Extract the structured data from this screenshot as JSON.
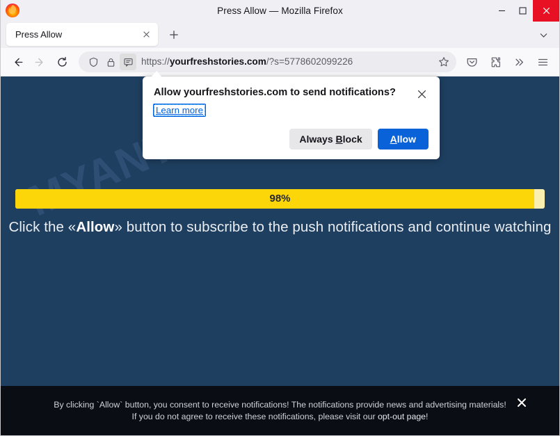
{
  "window": {
    "title": "Press Allow — Mozilla Firefox",
    "controls": {
      "minimize": "minimize",
      "maximize": "maximize",
      "close": "close"
    }
  },
  "tabs": {
    "items": [
      {
        "label": "Press Allow",
        "close_label": "Close tab"
      }
    ],
    "new_tab_label": "Open a new tab",
    "list_all_label": "List all tabs"
  },
  "toolbar": {
    "back_label": "Go back one page",
    "forward_label": "Go forward one page",
    "reload_label": "Reload current page",
    "shield_label": "Enhanced tracking protection",
    "lock_label": "Connection secure",
    "permission_label": "Notifications permission requested",
    "bookmark_label": "Bookmark this page",
    "pocket_label": "Save to Pocket",
    "extensions_label": "Extensions",
    "overflow_label": "More tools",
    "menu_label": "Open application menu"
  },
  "urlbar": {
    "scheme": "https://",
    "host": "yourfreshstories.com",
    "path": "/?s=5778602099226",
    "full_url": "https://yourfreshstories.com/?s=5778602099226"
  },
  "doorhanger": {
    "title": "Allow yourfreshstories.com to send notifications?",
    "learn_more": "Learn more",
    "close_label": "Close",
    "block_button": "Always Block",
    "block_button_pre": "Always ",
    "block_button_accel": "B",
    "block_button_post": "lock",
    "allow_button": "Allow",
    "allow_button_accel": "A",
    "allow_button_post": "llow",
    "primary_color": "#0a62d8"
  },
  "page": {
    "watermark": "MYANTISPYWARE.COM",
    "progress": {
      "percent_label": "98%",
      "percent_value": 98,
      "fill_color": "#fdd60a",
      "track_color": "#fbefb0"
    },
    "cta": {
      "prefix": "Click the «",
      "emphasis": "Allow",
      "suffix": "» button to subscribe to the push notifications and continue watching"
    },
    "background_color": "#1e3f60"
  },
  "consent": {
    "line1": "By clicking `Allow` button, you consent to receive notifications! The notifications provide news and advertising materials! If you do",
    "line2_pre": "not agree to receive these notifications, please visit our ",
    "link": "opt-out page",
    "line2_post": "!",
    "close_label": "×",
    "background_color": "#0b0d14"
  }
}
